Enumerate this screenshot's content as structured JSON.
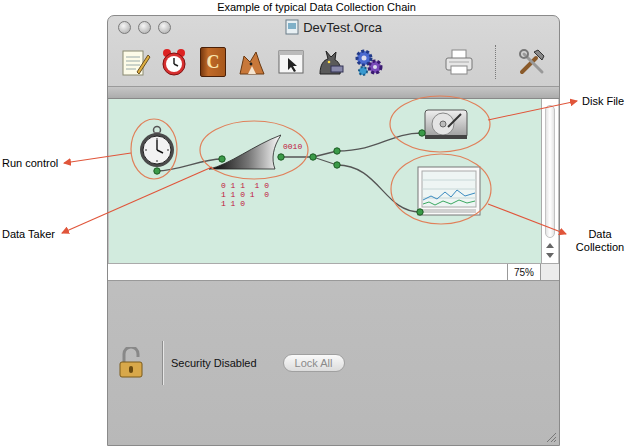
{
  "caption": "Example of typical Data Collection Chain",
  "window": {
    "title": "DevTest.Orca"
  },
  "toolbar": {
    "badge": "C"
  },
  "annotations": [
    {
      "label": "Run control"
    },
    {
      "label": "Data Taker"
    },
    {
      "label": "Disk File"
    },
    {
      "label": "Data Collection"
    }
  ],
  "data_taker": {
    "bits": [
      "0010",
      "0 1 1  1 0",
      "1 1 0 1  0",
      "1 1 0"
    ]
  },
  "zoom": "75%",
  "security": {
    "status": "Security Disabled",
    "locked": false,
    "button": {
      "label": "Lock All",
      "disabled": true
    }
  }
}
